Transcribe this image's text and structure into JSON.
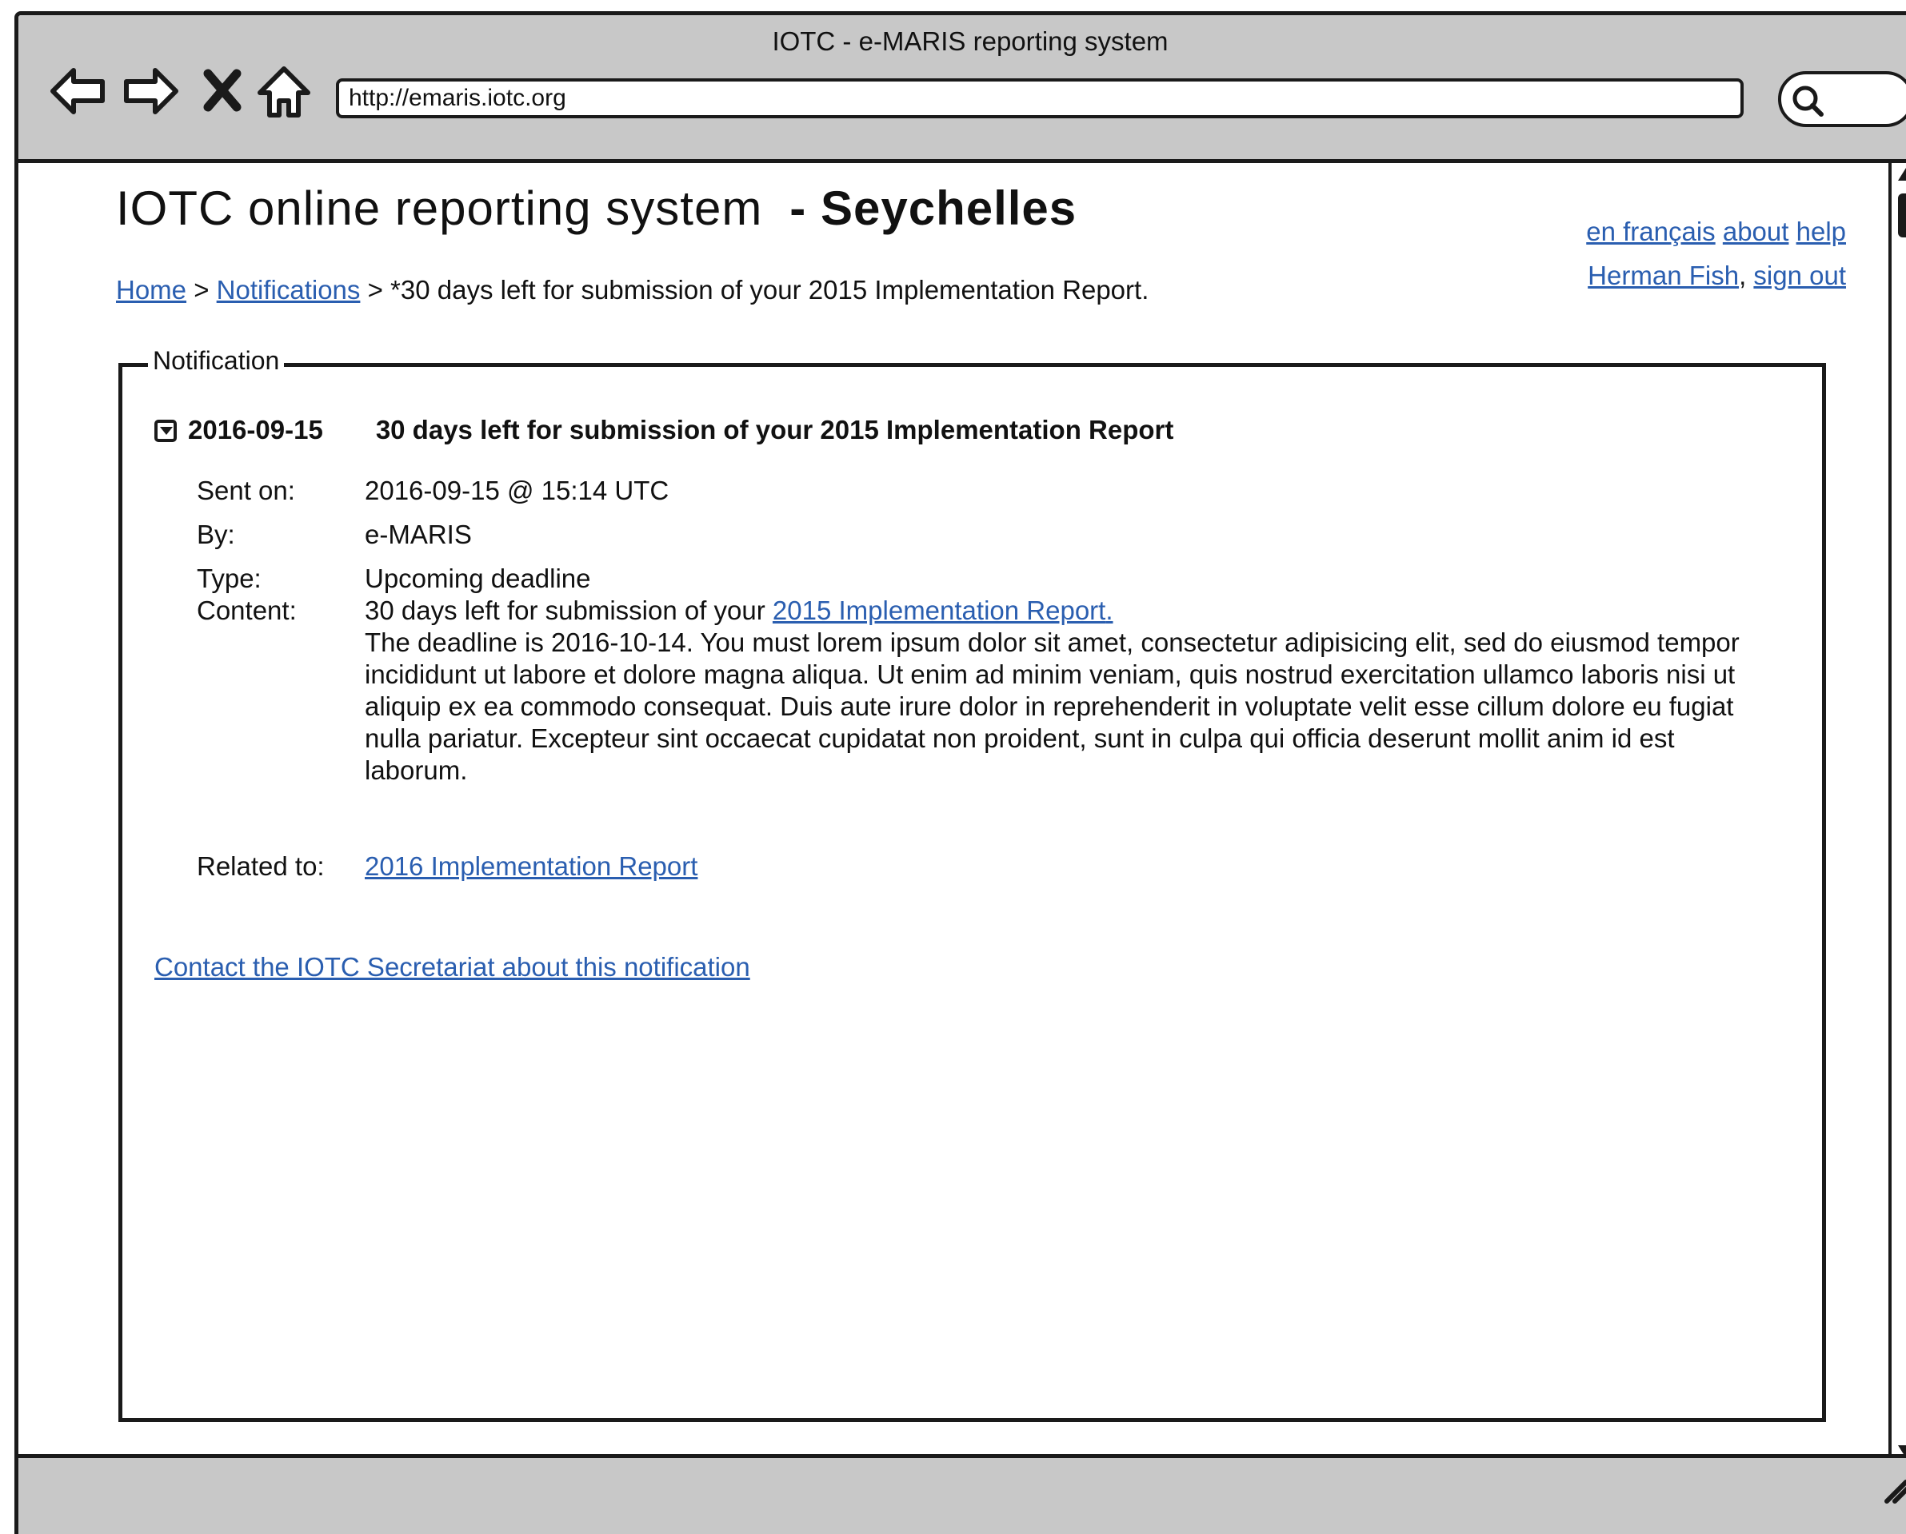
{
  "window": {
    "title": "IOTC - e-MARIS reporting system"
  },
  "browser": {
    "url": "http://emaris.iotc.org"
  },
  "header": {
    "app_title": "IOTC online reporting system",
    "country": "- Seychelles",
    "links": {
      "french": "en français",
      "about": "about",
      "help": "help",
      "user": "Herman Fish",
      "signout": "sign out",
      "separator": ","
    }
  },
  "breadcrumb": {
    "home": "Home",
    "sep1": ">",
    "notifications": "Notifications",
    "sep2": ">",
    "current": "*30 days left for submission of your 2015 Implementation Report."
  },
  "notification": {
    "legend": "Notification",
    "date": "2016-09-15",
    "subject": "30 days left for submission of your 2015 Implementation Report",
    "labels": {
      "sent_on": "Sent on:",
      "by": "By:",
      "type": "Type:",
      "content": "Content:",
      "related": "Related to:"
    },
    "sent_on": "2016-09-15 @ 15:14 UTC",
    "by": "e-MARIS",
    "type": "Upcoming deadline",
    "content_prefix": "30 days left for submission of your",
    "content_link": "2015 Implementation Report",
    "content_link_suffix": ".",
    "content_body": "The deadline is 2016-10-14. You must lorem ipsum dolor sit amet, consectetur adipisicing elit, sed do eiusmod tempor incididunt ut labore et dolore magna aliqua. Ut enim ad minim veniam, quis nostrud exercitation ullamco laboris nisi ut aliquip ex ea commodo consequat. Duis aute irure dolor in reprehenderit in voluptate velit esse cillum dolore eu fugiat nulla pariatur. Excepteur sint occaecat cupidatat non proident, sunt in culpa qui officia deserunt mollit anim id est laborum.",
    "related": "2016 Implementation Report",
    "contact": "Contact the IOTC Secretariat about this notification"
  },
  "icons": [
    "back-icon",
    "forward-icon",
    "stop-icon",
    "home-icon",
    "search-icon",
    "collapse-icon",
    "scroll-up-icon",
    "scroll-down-icon",
    "resize-grip-icon"
  ]
}
